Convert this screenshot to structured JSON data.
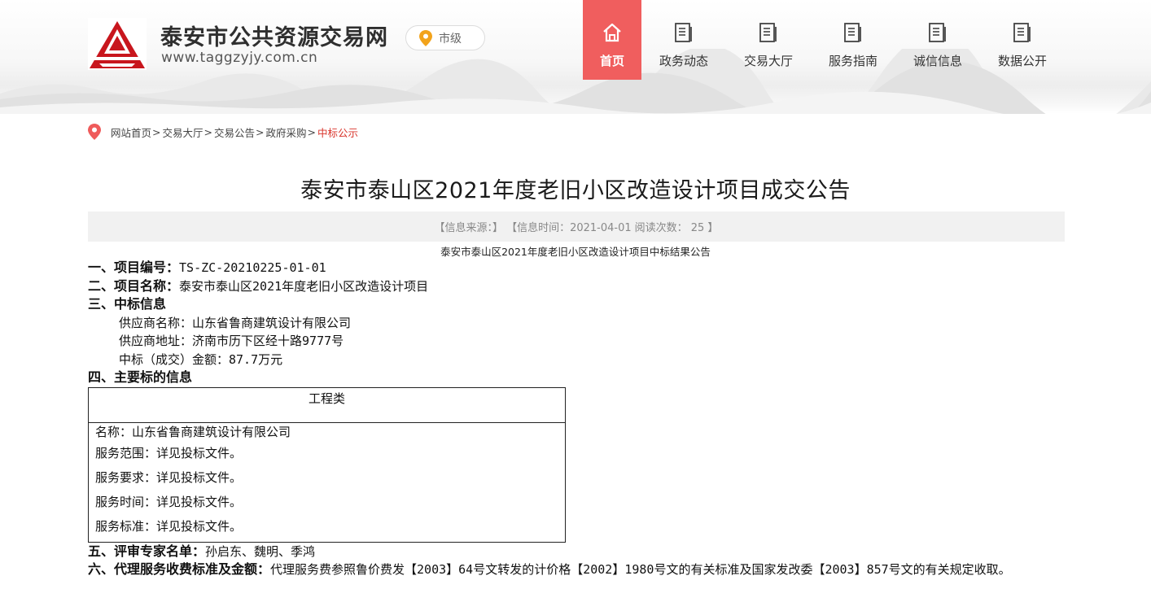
{
  "header": {
    "site_title": "泰安市公共资源交易网",
    "site_url": "www.taggzyjy.com.cn",
    "city_label": "市级",
    "accent_color": "#f05e5e",
    "logo_color": "#c8161d"
  },
  "nav": [
    {
      "label": "首页",
      "icon": "home-icon",
      "active": true
    },
    {
      "label": "政务动态",
      "icon": "document-icon",
      "active": false
    },
    {
      "label": "交易大厅",
      "icon": "document-icon",
      "active": false
    },
    {
      "label": "服务指南",
      "icon": "document-icon",
      "active": false
    },
    {
      "label": "诚信信息",
      "icon": "document-icon",
      "active": false
    },
    {
      "label": "数据公开",
      "icon": "document-icon",
      "active": false
    }
  ],
  "breadcrumb": {
    "items": [
      "网站首页",
      "交易大厅",
      "交易公告",
      "政府采购"
    ],
    "separator": ">",
    "current": "中标公示"
  },
  "article": {
    "title": "泰安市泰山区2021年度老旧小区改造设计项目成交公告",
    "meta": {
      "source": "【信息来源：】",
      "time": "【信息时间：2021-04-01",
      "reads": "阅读次数： 25 】"
    },
    "subtitle": "泰安市泰山区2021年度老旧小区改造设计项目中标结果公告",
    "sections": {
      "s1_label": "一、项目编号：",
      "s1_value": "TS-ZC-20210225-01-01",
      "s2_label": "二、项目名称：",
      "s2_value": "泰安市泰山区2021年度老旧小区改造设计项目",
      "s3_label": "三、中标信息",
      "supplier_name": "供应商名称：山东省鲁商建筑设计有限公司",
      "supplier_address": "供应商地址：济南市历下区经十路9777号",
      "amount": "中标（成交）金额：87.7万元",
      "s4_label": "四、主要标的信息",
      "table_header": "工程类",
      "table_rows": [
        "名称：山东省鲁商建筑设计有限公司",
        "服务范围：详见投标文件。",
        "服务要求：详见投标文件。",
        "服务时间：详见投标文件。",
        "服务标准：详见投标文件。"
      ],
      "s5_label": "五、评审专家名单：",
      "s5_value": "孙启东、魏明、季鸿",
      "s6_label": "六、代理服务收费标准及金额：",
      "s6_value": "代理服务费参照鲁价费发【2003】64号文转发的计价格【2002】1980号文的有关标准及国家发改委【2003】857号文的有关规定收取。"
    }
  }
}
